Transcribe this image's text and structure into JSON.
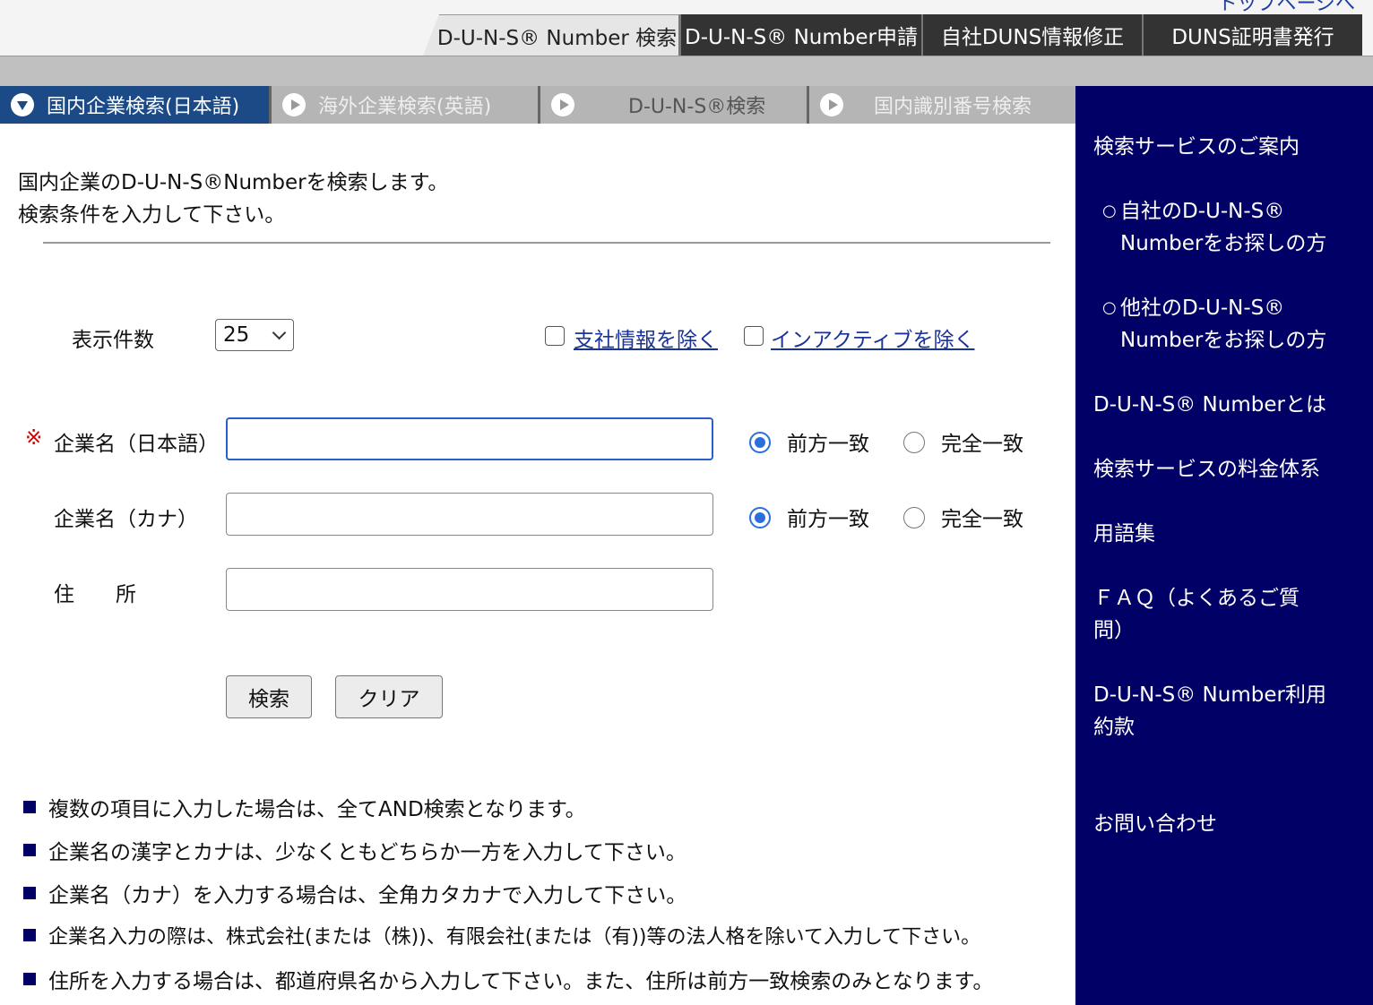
{
  "top": {
    "corner_link": "トップページへ",
    "tabs": [
      {
        "label": "D-U-N-S® Number 検索",
        "active": true
      },
      {
        "label": "D-U-N-S® Number申請",
        "active": false
      },
      {
        "label": "自社DUNS情報修正",
        "active": false
      },
      {
        "label": "DUNS証明書発行",
        "active": false
      }
    ]
  },
  "subtabs": [
    {
      "label": "国内企業検索(日本語)",
      "active": true
    },
    {
      "label": "海外企業検索(英語)",
      "active": false
    },
    {
      "label": "D-U-N-S®検索",
      "active": false
    },
    {
      "label": "国内識別番号検索",
      "active": false
    }
  ],
  "intro": {
    "line1": "国内企業のD-U-N-S®Numberを検索します。",
    "line2": "検索条件を入力して下さい。"
  },
  "form": {
    "count_label": "表示件数",
    "count_value": "25",
    "exclude_branch": "支社情報を除く",
    "exclude_inactive": "インアクティブを除く",
    "required_mark": "※",
    "name_jp_label": "企業名（日本語）",
    "name_kana_label": "企業名（カナ）",
    "address_label": "住　　所",
    "name_jp_value": "",
    "name_kana_value": "",
    "address_value": "",
    "match_prefix": "前方一致",
    "match_exact": "完全一致",
    "search_button": "検索",
    "clear_button": "クリア"
  },
  "notes": [
    "複数の項目に入力した場合は、全てAND検索となります。",
    "企業名の漢字とカナは、少なくともどちらか一方を入力して下さい。",
    "企業名（カナ）を入力する場合は、全角カタカナで入力して下さい。",
    "企業名入力の際は、株式会社(または（株))、有限会社(または（有))等の法人格を除いて入力して下さい。",
    "住所を入力する場合は、都道府県名から入力して下さい。また、住所は前方一致検索のみとなります。"
  ],
  "sidebar": {
    "guide": "検索サービスのご案内",
    "own_line1": "自社のD-U-N-S®",
    "own_line2": "Numberをお探しの方",
    "other_line1": "他社のD-U-N-S®",
    "other_line2": "Numberをお探しの方",
    "what_is": "D-U-N-S® Numberとは",
    "pricing": "検索サービスの料金体系",
    "glossary": "用語集",
    "faq": "ＦＡＱ（よくあるご質問）",
    "terms": "D-U-N-S® Number利用約款",
    "contact": "お問い合わせ"
  },
  "colors": {
    "sidebar_bg": "#000066",
    "active_subtab": "#1b4a86",
    "link": "#1a3399",
    "required": "#cc0000"
  }
}
